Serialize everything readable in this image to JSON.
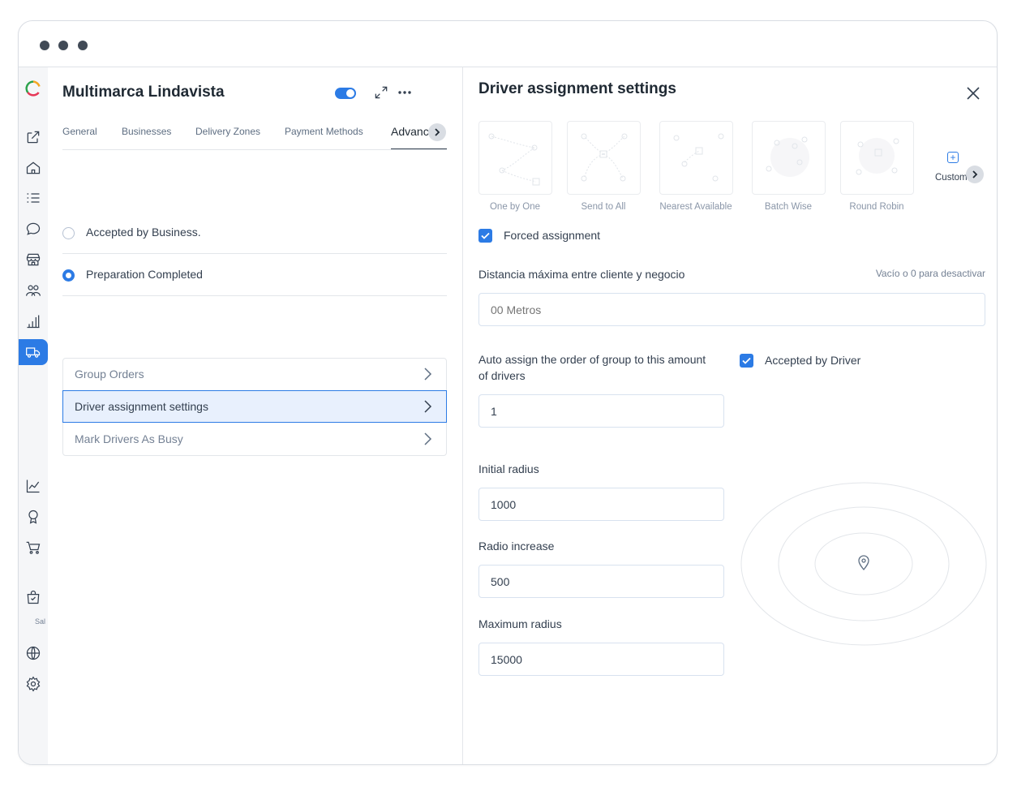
{
  "window": {
    "dot_color": "#414a56"
  },
  "colors": {
    "accent": "#2c7be5",
    "text": "#344050",
    "muted": "#748194"
  },
  "sidebar": {
    "items": [
      {
        "icon": "external-link-icon"
      },
      {
        "icon": "home-icon"
      },
      {
        "icon": "list-icon"
      },
      {
        "icon": "chat-icon"
      },
      {
        "icon": "store-icon"
      },
      {
        "icon": "users-icon"
      },
      {
        "icon": "bar-chart-icon"
      },
      {
        "icon": "delivery-truck-icon",
        "active": true
      },
      {
        "icon": "line-chart-icon"
      },
      {
        "icon": "award-icon"
      },
      {
        "icon": "cart-icon"
      },
      {
        "icon": "bag-check-icon"
      },
      {
        "icon": "globe-icon"
      },
      {
        "icon": "gear-icon"
      }
    ],
    "section_label": "Sal"
  },
  "business": {
    "title": "Multimarca Lindavista",
    "enabled": true
  },
  "tabs": [
    {
      "label": "General"
    },
    {
      "label": "Businesses"
    },
    {
      "label": "Delivery Zones"
    },
    {
      "label": "Payment Methods"
    },
    {
      "label": "Advanced",
      "active": true
    }
  ],
  "trigger_options": [
    {
      "label": "Accepted by Business.",
      "selected": false
    },
    {
      "label": "Preparation Completed",
      "selected": true
    }
  ],
  "advanced_menu": [
    {
      "label": "Group Orders",
      "active": false
    },
    {
      "label": "Driver assignment settings",
      "active": true
    },
    {
      "label": "Mark Drivers As Busy",
      "active": false
    }
  ],
  "panel": {
    "title": "Driver assignment settings",
    "strategies": [
      {
        "label": "One by One"
      },
      {
        "label": "Send to All"
      },
      {
        "label": "Nearest Available"
      },
      {
        "label": "Batch Wise"
      },
      {
        "label": "Round Robin"
      }
    ],
    "custom_label": "Custom",
    "forced_assignment": {
      "label": "Forced assignment",
      "checked": true
    },
    "max_distance": {
      "label": "Distancia máxima entre cliente y negocio",
      "hint": "Vacío o 0 para desactivar",
      "placeholder": "00 Metros",
      "value": ""
    },
    "auto_assign": {
      "label_line1": "Auto assign the order of group to this amount",
      "label_line2": "of drivers",
      "value": "1"
    },
    "accepted_by_driver": {
      "label": "Accepted by Driver",
      "checked": true
    },
    "initial_radius": {
      "label": "Initial radius",
      "value": "1000"
    },
    "radio_increase": {
      "label": "Radio increase",
      "value": "500"
    },
    "maximum_radius": {
      "label": "Maximum radius",
      "value": "15000"
    }
  }
}
